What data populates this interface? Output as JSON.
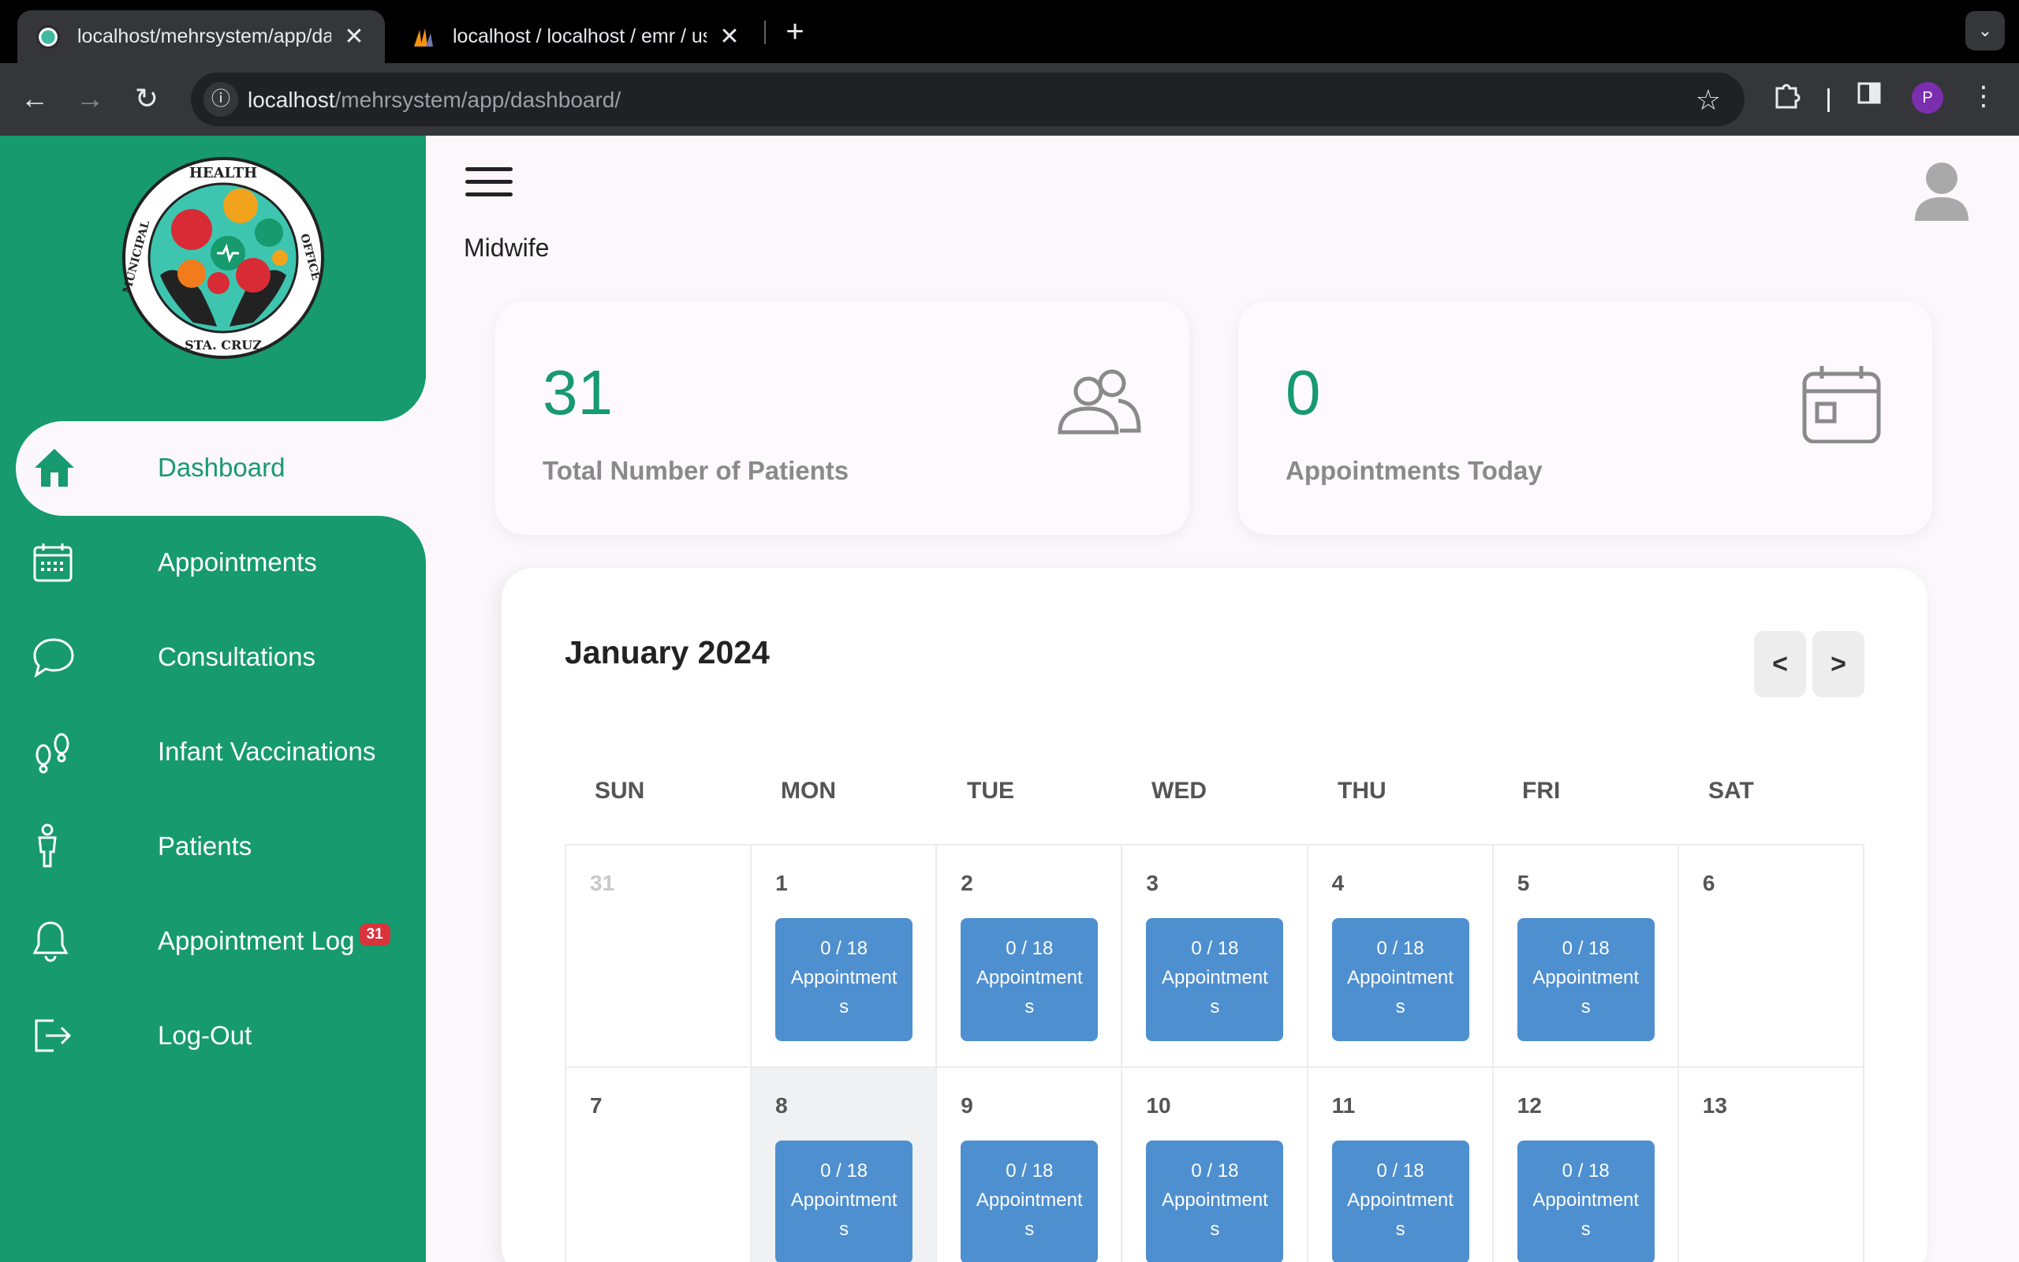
{
  "browser": {
    "tabs": [
      {
        "title": "localhost/mehrsystem/app/da",
        "active": true
      },
      {
        "title": "localhost / localhost / emr / us",
        "active": false
      }
    ],
    "new_tab": "+",
    "url_host": "localhost",
    "url_path": "/mehrsystem/app/dashboard/",
    "profile_initial": "P"
  },
  "sidebar": {
    "logo_text_top": "HEALTH",
    "logo_text_left": "MUNICIPAL",
    "logo_text_right": "OFFICE",
    "logo_text_bottom": "STA. CRUZ",
    "items": [
      {
        "label": "Dashboard",
        "icon": "home-icon",
        "active": true
      },
      {
        "label": "Appointments",
        "icon": "calendar-icon",
        "active": false
      },
      {
        "label": "Consultations",
        "icon": "chat-bubble-icon",
        "active": false
      },
      {
        "label": "Infant Vaccinations",
        "icon": "footprints-icon",
        "active": false
      },
      {
        "label": "Patients",
        "icon": "person-icon",
        "active": false
      },
      {
        "label": "Appointment Log",
        "icon": "bell-icon",
        "active": false,
        "badge": "31"
      },
      {
        "label": "Log-Out",
        "icon": "logout-icon",
        "active": false
      }
    ]
  },
  "header": {
    "role": "Midwife"
  },
  "stats": {
    "patients": {
      "value": "31",
      "label": "Total Number of Patients"
    },
    "appointments_today": {
      "value": "0",
      "label": "Appointments Today"
    }
  },
  "calendar": {
    "title": "January 2024",
    "prev": "<",
    "next": ">",
    "weekdays": [
      "SUN",
      "MON",
      "TUE",
      "WED",
      "THU",
      "FRI",
      "SAT"
    ],
    "appt_line1": "0 / 18",
    "appt_line2": "Appointment",
    "appt_line3": "s",
    "weeks": [
      [
        {
          "day": "31",
          "muted": true
        },
        {
          "day": "1",
          "appt": true
        },
        {
          "day": "2",
          "appt": true
        },
        {
          "day": "3",
          "appt": true
        },
        {
          "day": "4",
          "appt": true
        },
        {
          "day": "5",
          "appt": true
        },
        {
          "day": "6"
        }
      ],
      [
        {
          "day": "7"
        },
        {
          "day": "8",
          "appt": true,
          "today": true
        },
        {
          "day": "9",
          "appt": true
        },
        {
          "day": "10",
          "appt": true
        },
        {
          "day": "11",
          "appt": true
        },
        {
          "day": "12",
          "appt": true
        },
        {
          "day": "13"
        }
      ]
    ]
  },
  "colors": {
    "sidebar": "#169a6e",
    "accent_number": "#169a6e",
    "appointment_block": "#4e8fd0",
    "badge": "#d9343b"
  }
}
